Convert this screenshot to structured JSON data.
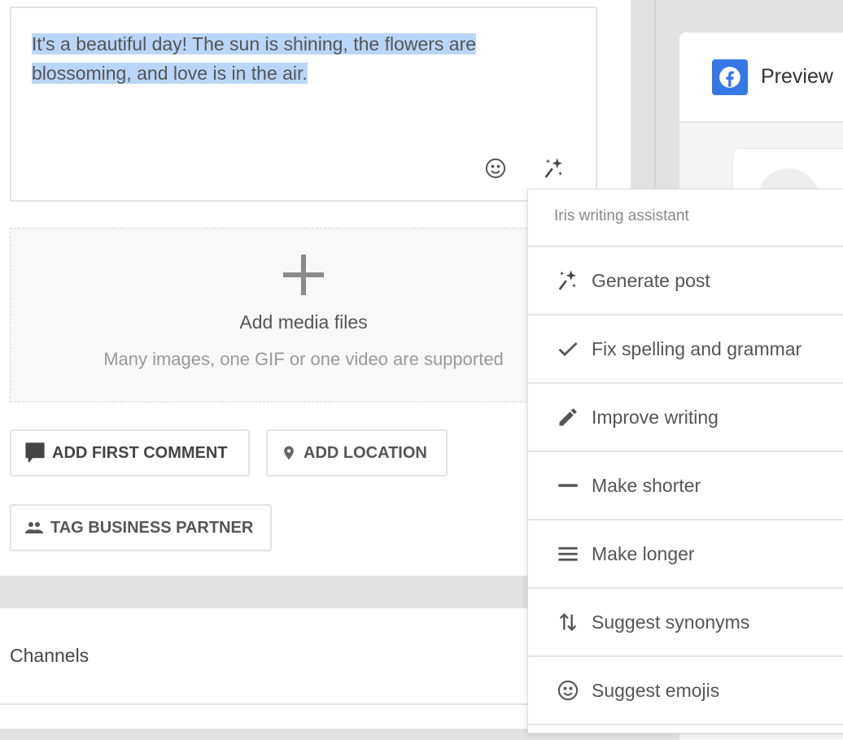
{
  "editor": {
    "text": "It's a beautiful day! The sun is shining, the flowers are blossoming, and love is in the air.",
    "line1": "It's a beautiful day! The sun is shining, the flowers are ",
    "line2": "blossoming, and love is in the air.",
    "icons": [
      "emoji-icon",
      "magic-wand-icon"
    ]
  },
  "media": {
    "title": "Add media files",
    "subtitle": "Many images, one GIF or one video are supported"
  },
  "buttons": {
    "first_comment": "ADD FIRST COMMENT",
    "location": "ADD LOCATION",
    "tag_partner": "TAG BUSINESS PARTNER"
  },
  "channels": {
    "label": "Channels"
  },
  "preview": {
    "title": "Preview",
    "network_icon": "facebook-icon",
    "brand_color": "#3578e5"
  },
  "assistant_menu": {
    "title": "Iris writing assistant",
    "items": [
      {
        "label": "Generate post",
        "icon": "sparkles-icon"
      },
      {
        "label": "Fix spelling and grammar",
        "icon": "check-icon"
      },
      {
        "label": "Improve writing",
        "icon": "pencil-icon"
      },
      {
        "label": "Make shorter",
        "icon": "minus-icon"
      },
      {
        "label": "Make longer",
        "icon": "lines-icon"
      },
      {
        "label": "Suggest synonyms",
        "icon": "swap-vertical-icon"
      },
      {
        "label": "Suggest emojis",
        "icon": "emoji-icon"
      }
    ]
  },
  "colors": {
    "selection": "#b9d6f8"
  }
}
